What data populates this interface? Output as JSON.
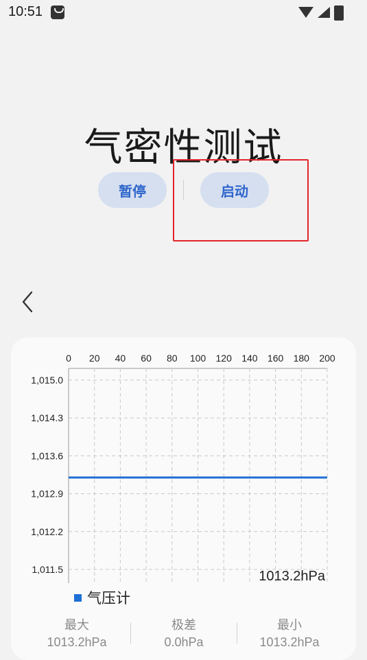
{
  "status_bar": {
    "time": "10:51",
    "icons": [
      "notification-bag-icon",
      "wifi-icon",
      "signal-icon",
      "battery-charging-icon"
    ]
  },
  "page": {
    "title": "气密性测试"
  },
  "controls": {
    "pause_label": "暂停",
    "start_label": "启动",
    "accent_color": "#2f66cc",
    "button_bg": "#d5dff0",
    "highlight_color": "#e2242a"
  },
  "nav": {
    "back_icon": "chevron-left-icon"
  },
  "chart_data": {
    "type": "line",
    "x_ticks": [
      "0",
      "20",
      "40",
      "60",
      "80",
      "100",
      "120",
      "140",
      "160",
      "180",
      "200"
    ],
    "y_ticks": [
      "1,015.0",
      "1,014.3",
      "1,013.6",
      "1,012.9",
      "1,012.2",
      "1,011.5"
    ],
    "xlim": [
      0,
      200
    ],
    "ylim": [
      1011.5,
      1015.0
    ],
    "grid": true,
    "series": [
      {
        "name": "气压计",
        "color": "#1f6fd6",
        "x": [
          0,
          200
        ],
        "y": [
          1013.2,
          1013.2
        ]
      }
    ],
    "current_value_label": "1013.2hPa"
  },
  "stats": {
    "max_label": "最大",
    "max_value": "1013.2hPa",
    "range_label": "极差",
    "range_value": "0.0hPa",
    "min_label": "最小",
    "min_value": "1013.2hPa"
  }
}
